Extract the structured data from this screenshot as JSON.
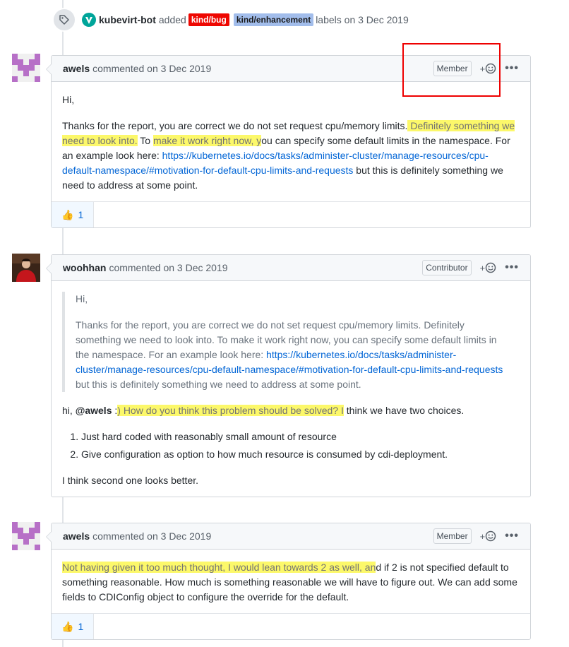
{
  "event": {
    "actor": "kubevirt-bot",
    "action": "added",
    "labels": [
      {
        "text": "kind/bug",
        "bg": "#ee0701",
        "fg": "#ffffff"
      },
      {
        "text": "kind/enhancement",
        "bg": "#a2bdeb",
        "fg": "#1a1a1a"
      }
    ],
    "suffix": "labels on 3 Dec 2019"
  },
  "comments": [
    {
      "author": "awels",
      "meta": "commented on 3 Dec 2019",
      "role": "Member",
      "body": {
        "greeting": "Hi,",
        "p2a": "Thanks for the report, you are correct we do not set request cpu/memory limits.",
        "p2b": " Definitely something we need to look into.",
        "p2c": " To ",
        "p2d": "make it work right now, y",
        "p2e": "ou can specify some default limits in the namespace. For an example look here: ",
        "link": "https://kubernetes.io/docs/tasks/administer-cluster/manage-resources/cpu-default-namespace/#motivation-for-default-cpu-limits-and-requests",
        "p2f": " but this is definitely something we need to address at some point."
      },
      "reaction": {
        "emoji": "👍",
        "count": "1"
      }
    },
    {
      "author": "woohhan",
      "meta": "commented on 3 Dec 2019",
      "role": "Contributor",
      "quote": {
        "greeting": "Hi,",
        "text": "Thanks for the report, you are correct we do not set request cpu/memory limits. Definitely something we need to look into. To make it work right now, you can specify some default limits in the namespace. For an example look here: ",
        "link": "https://kubernetes.io/docs/tasks/administer-cluster/manage-resources/cpu-default-namespace/#motivation-for-default-cpu-limits-and-requests",
        "tail": " but this is definitely something we need to address at some point."
      },
      "line1a": "hi, ",
      "mention": "@awels",
      "line1b": " :",
      "line1c": ") How do you think this problem should be solved? I",
      "line1d": " think we have two choices.",
      "list": [
        "Just hard coded with reasonably small amount of resource",
        "Give configuration as option to how much resource is consumed by cdi-deployment."
      ],
      "closing": "I think second one looks better."
    },
    {
      "author": "awels",
      "meta": "commented on 3 Dec 2019",
      "role": "Member",
      "body_hl": "Not having given it too much thought, I would lean towards 2 as well, an",
      "body_rest": "d if 2 is not specified default to something reasonable. How much is something reasonable we will have to figure out. We can add some fields to CDIConfig object to configure the override for the default.",
      "reaction": {
        "emoji": "👍",
        "count": "1"
      }
    }
  ],
  "icons": {
    "plus": "+",
    "dots": "•••"
  },
  "colors": {
    "link": "#0366d6",
    "highlight": "#fcf86a",
    "annotation": "#ee0000"
  }
}
